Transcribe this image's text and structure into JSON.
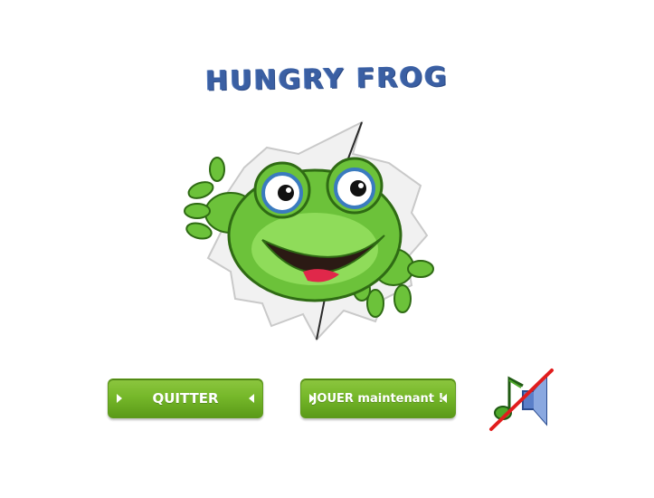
{
  "game": {
    "title": "HUNGRY FROG"
  },
  "menu": {
    "quit_label": "QUITTER",
    "play_label": "JOUER maintenant !"
  },
  "sound": {
    "icon": "sound-muted-icon",
    "muted": true
  },
  "colors": {
    "title": "#3a5fa3",
    "button_green": "#76b82a",
    "frog_green": "#6cc23a",
    "mute_slash": "#e11d1d"
  }
}
